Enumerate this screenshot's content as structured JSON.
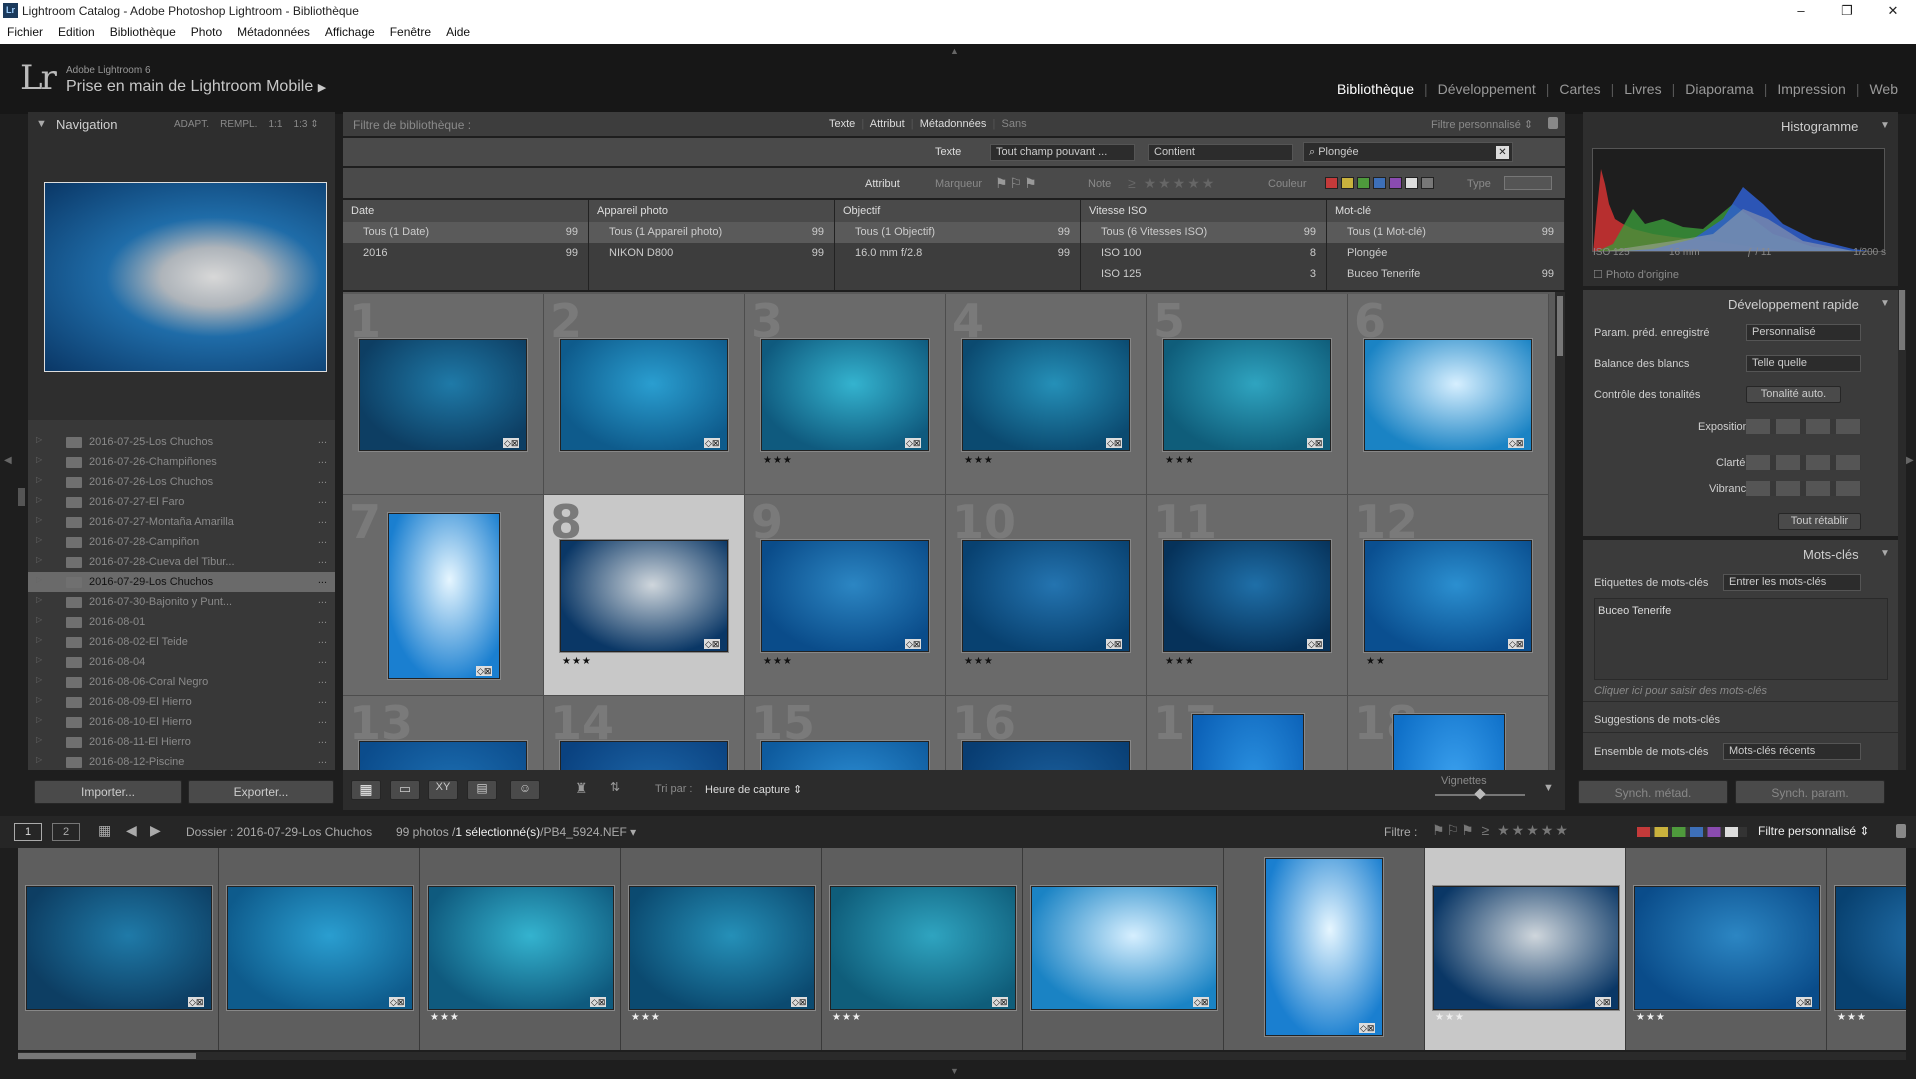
{
  "window": {
    "title": "Lightroom Catalog - Adobe Photoshop Lightroom - Bibliothèque",
    "lr_icon": "Lr",
    "minimize": "–",
    "maximize": "❐",
    "close": "✕"
  },
  "menu": [
    "Fichier",
    "Edition",
    "Bibliothèque",
    "Photo",
    "Métadonnées",
    "Affichage",
    "Fenêtre",
    "Aide"
  ],
  "identity": {
    "logo": "Lr",
    "version": "Adobe Lightroom 6",
    "plate": "Prise en main de Lightroom Mobile"
  },
  "modules": [
    "Bibliothèque",
    "Développement",
    "Cartes",
    "Livres",
    "Diaporama",
    "Impression",
    "Web"
  ],
  "active_module": "Bibliothèque",
  "navigator": {
    "title": "Navigation",
    "zoom": [
      "ADAPT.",
      "REMPL.",
      "1:1",
      "1:3"
    ]
  },
  "folders": [
    "2016-07-25-Los Chuchos",
    "2016-07-26-Champiñones",
    "2016-07-26-Los Chuchos",
    "2016-07-27-El Faro",
    "2016-07-27-Montaña Amarilla",
    "2016-07-28-Campiñon",
    "2016-07-28-Cueva del Tibur...",
    "2016-07-29-Los Chuchos",
    "2016-07-30-Bajonito y Punt...",
    "2016-08-01",
    "2016-08-02-El Teide",
    "2016-08-04",
    "2016-08-06-Coral Negro",
    "2016-08-09-El Hierro",
    "2016-08-10-El Hierro",
    "2016-08-11-El Hierro",
    "2016-08-12-Piscine"
  ],
  "selected_folder_index": 7,
  "left_buttons": {
    "import": "Importer...",
    "export": "Exporter..."
  },
  "filter": {
    "title": "Filtre de bibliothèque :",
    "tabs": [
      "Texte",
      "Attribut",
      "Métadonnées",
      "Sans"
    ],
    "preset": "Filtre personnalisé",
    "text_label": "Texte",
    "text_field": "Tout champ pouvant ...",
    "text_rule": "Contient",
    "search_value": "Plongée",
    "attr_label": "Attribut",
    "flag_label": "Marqueur",
    "rating_label": "Note",
    "color_label": "Couleur",
    "type_label": "Type",
    "color_swatches": [
      "#c43a3a",
      "#c9b23d",
      "#4e9a3c",
      "#3d6fb8",
      "#8a4bb0",
      "#dddddd",
      "#777777"
    ]
  },
  "metadata_columns": [
    {
      "title": "Date",
      "rows": [
        {
          "label": "Tous (1 Date)",
          "count": "99"
        },
        {
          "label": "2016",
          "count": "99"
        }
      ]
    },
    {
      "title": "Appareil photo",
      "rows": [
        {
          "label": "Tous (1 Appareil photo)",
          "count": "99"
        },
        {
          "label": "NIKON D800",
          "count": "99"
        }
      ]
    },
    {
      "title": "Objectif",
      "rows": [
        {
          "label": "Tous (1 Objectif)",
          "count": "99"
        },
        {
          "label": "16.0 mm f/2.8",
          "count": "99"
        }
      ]
    },
    {
      "title": "Vitesse ISO",
      "rows": [
        {
          "label": "Tous (6 Vitesses ISO)",
          "count": "99"
        },
        {
          "label": "ISO 100",
          "count": "8"
        },
        {
          "label": "ISO 125",
          "count": "3"
        }
      ]
    },
    {
      "title": "Mot-clé",
      "rows": [
        {
          "label": "Tous (1 Mot-clé)",
          "count": "99"
        },
        {
          "label": "Plongée",
          "count": ""
        },
        {
          "label": "Buceo Tenerife",
          "count": "99"
        }
      ]
    }
  ],
  "grid": [
    {
      "n": "1",
      "stars": "",
      "orient": "h",
      "c1": "#0d3e63",
      "c2": "#1f7aa8"
    },
    {
      "n": "2",
      "stars": "",
      "orient": "h",
      "c1": "#0e5b8c",
      "c2": "#2a9ed0"
    },
    {
      "n": "3",
      "stars": "★★★",
      "orient": "h",
      "c1": "#0f5a7e",
      "c2": "#34b3cf"
    },
    {
      "n": "4",
      "stars": "★★★",
      "orient": "h",
      "c1": "#0b4a70",
      "c2": "#2590b8"
    },
    {
      "n": "5",
      "stars": "★★★",
      "orient": "h",
      "c1": "#0f5d7a",
      "c2": "#2fa4c0"
    },
    {
      "n": "6",
      "stars": "",
      "orient": "h",
      "c1": "#1a83c4",
      "c2": "#d6efff"
    },
    {
      "n": "7",
      "stars": "",
      "orient": "v",
      "c1": "#1a7fd0",
      "c2": "#e6f6ff"
    },
    {
      "n": "8",
      "stars": "★★★",
      "orient": "h",
      "c1": "#0a3766",
      "c2": "#cfd6dc",
      "selected": true
    },
    {
      "n": "9",
      "stars": "★★★",
      "orient": "h",
      "c1": "#0a4c8a",
      "c2": "#2c86c3"
    },
    {
      "n": "10",
      "stars": "★★★",
      "orient": "h",
      "c1": "#084170",
      "c2": "#2474b0"
    },
    {
      "n": "11",
      "stars": "★★★",
      "orient": "h",
      "c1": "#06325a",
      "c2": "#1f6fa8"
    },
    {
      "n": "12",
      "stars": "★★",
      "orient": "h",
      "c1": "#0a4f90",
      "c2": "#2b8fd0"
    },
    {
      "n": "13",
      "stars": "",
      "orient": "h",
      "c1": "#0b4c8c",
      "c2": "#1c6db0"
    },
    {
      "n": "14",
      "stars": "",
      "orient": "h",
      "c1": "#0a4280",
      "c2": "#1c64a6"
    },
    {
      "n": "15",
      "stars": "",
      "orient": "h",
      "c1": "#0e5b9e",
      "c2": "#2a8ad0"
    },
    {
      "n": "16",
      "stars": "",
      "orient": "h",
      "c1": "#083d72",
      "c2": "#1a5d9a"
    },
    {
      "n": "17",
      "stars": "",
      "orient": "v",
      "c1": "#0c62b8",
      "c2": "#2a90e0"
    },
    {
      "n": "18",
      "stars": "",
      "orient": "v",
      "c1": "#0f70c8",
      "c2": "#3aa0ee"
    }
  ],
  "toolbar": {
    "sort_label": "Tri par :",
    "sort_value": "Heure de capture",
    "thumbs_label": "Vignettes"
  },
  "histogram": {
    "title": "Histogramme",
    "iso": "ISO 125",
    "focal": "16 mm",
    "aperture": "ƒ / 11",
    "shutter": "1/200 s",
    "original": "Photo d'origine"
  },
  "quick_develop": {
    "title": "Développement rapide",
    "preset_label": "Param. préd. enregistré",
    "preset_value": "Personnalisé",
    "wb_label": "Balance des blancs",
    "wb_value": "Telle quelle",
    "tone_label": "Contrôle des tonalités",
    "auto_tone": "Tonalité auto.",
    "exposure": "Exposition",
    "clarity": "Clarté",
    "vibrance": "Vibrance",
    "reset": "Tout rétablir"
  },
  "keywords": {
    "title": "Mots-clés",
    "tags_label": "Etiquettes de mots-clés",
    "tags_mode": "Entrer les mots-clés",
    "value": "Buceo Tenerife",
    "placeholder": "Cliquer ici pour saisir des mots-clés",
    "suggestions": "Suggestions de mots-clés",
    "set_label": "Ensemble de mots-clés",
    "set_value": "Mots-clés récents"
  },
  "sync": {
    "meta": "Synch. métad.",
    "settings": "Synch. param."
  },
  "filmbar": {
    "screen1": "1",
    "screen2": "2",
    "folder": "Dossier : 2016-07-29-Los Chuchos",
    "count": "99 photos /",
    "selected": "1 sélectionné(s)",
    "file": "/PB4_5924.NEF",
    "filter_label": "Filtre :",
    "filter_value": "Filtre personnalisé"
  },
  "filmstrip": [
    {
      "stars": "",
      "c1": "#0d3e63",
      "c2": "#1f7aa8",
      "orient": "h"
    },
    {
      "stars": "",
      "c1": "#0e5b8c",
      "c2": "#2a9ed0",
      "orient": "h"
    },
    {
      "stars": "★★★",
      "c1": "#0f5a7e",
      "c2": "#34b3cf",
      "orient": "h"
    },
    {
      "stars": "★★★",
      "c1": "#0b4a70",
      "c2": "#2590b8",
      "orient": "h"
    },
    {
      "stars": "★★★",
      "c1": "#0f5d7a",
      "c2": "#2fa4c0",
      "orient": "h"
    },
    {
      "stars": "",
      "c1": "#1a83c4",
      "c2": "#d6efff",
      "orient": "h"
    },
    {
      "stars": "",
      "c1": "#1a7fd0",
      "c2": "#e6f6ff",
      "orient": "v"
    },
    {
      "stars": "★★★",
      "c1": "#0a3766",
      "c2": "#cfd6dc",
      "orient": "h",
      "selected": true
    },
    {
      "stars": "★★★",
      "c1": "#0a4c8a",
      "c2": "#2c86c3",
      "orient": "h"
    },
    {
      "stars": "★★★",
      "c1": "#084170",
      "c2": "#2474b0",
      "orient": "h"
    }
  ]
}
